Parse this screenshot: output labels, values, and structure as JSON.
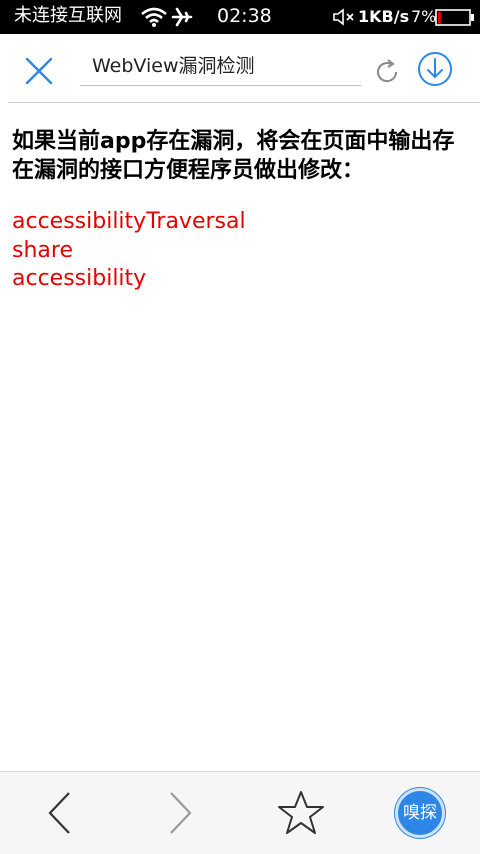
{
  "status_bar": {
    "carrier": "未连接互联网",
    "time": "02:38",
    "net_speed": "1KB/s",
    "battery_percent": "7%",
    "battery_level": 0.07,
    "battery_color": "#e60000",
    "icons": [
      "wifi-icon",
      "airplane-icon",
      "mute-icon",
      "battery-icon"
    ]
  },
  "toolbar": {
    "url_text": "WebView漏洞检测",
    "accent_color": "#2e86e6",
    "icons": [
      "close-icon",
      "reload-icon",
      "download-icon"
    ]
  },
  "content": {
    "heading": "如果当前app存在漏洞，将会在页面中输出存在漏洞的接口方便程序员做出修改：",
    "vulnerable_interfaces": [
      "accessibilityTraversal",
      "share",
      "accessibility"
    ],
    "list_color": "#e60000"
  },
  "bottom_bar": {
    "sniff_label": "嗅探",
    "icons": [
      "back-icon",
      "forward-icon",
      "star-icon"
    ]
  }
}
